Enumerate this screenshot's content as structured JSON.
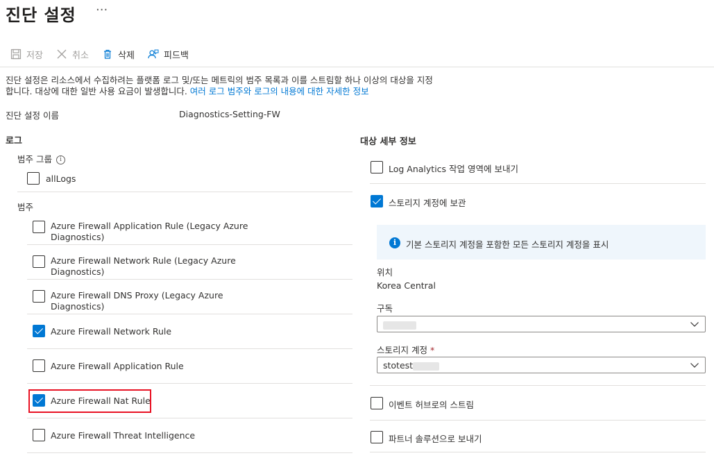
{
  "header": {
    "title": "진단 설정",
    "more": "···"
  },
  "toolbar": {
    "save_label": "저장",
    "cancel_label": "취소",
    "delete_label": "삭제",
    "feedback_label": "피드백"
  },
  "description": {
    "text_line1": "진단 설정은 리소스에서 수집하려는 플랫폼 로그 및/또는 메트릭의 범주 목록과 이를 스트림할 하나 이상의 대상을 지정",
    "text_line2": "합니다. 대상에 대한 일반 사용 요금이 발생합니다.",
    "link": "여러 로그 범주와 로그의 내용에 대한 자세한 정보"
  },
  "setting_name": {
    "label": "진단 설정 이름",
    "value": "Diagnostics-Setting-FW"
  },
  "logs": {
    "heading": "로그",
    "category_group_label": "범주 그룹",
    "category_group_info_icon": "info-icon",
    "alllogs": {
      "label": "allLogs",
      "checked": false
    },
    "categories_label": "범주",
    "categories": [
      {
        "label": "Azure Firewall Application Rule (Legacy Azure Diagnostics)",
        "checked": false
      },
      {
        "label": "Azure Firewall Network Rule (Legacy Azure Diagnostics)",
        "checked": false
      },
      {
        "label": "Azure Firewall DNS Proxy (Legacy Azure Diagnostics)",
        "checked": false
      },
      {
        "label": "Azure Firewall Network Rule",
        "checked": true
      },
      {
        "label": "Azure Firewall Application Rule",
        "checked": false
      },
      {
        "label": "Azure Firewall Nat Rule",
        "checked": true
      },
      {
        "label": "Azure Firewall Threat Intelligence",
        "checked": false
      }
    ]
  },
  "destination": {
    "heading": "대상 세부 정보",
    "log_analytics": {
      "label": "Log Analytics 작업 영역에 보내기",
      "checked": false
    },
    "storage": {
      "label": "스토리지 계정에 보관",
      "checked": true
    },
    "info_text": "기본 스토리지 계정을 포함한 모든 스토리지 계정을 표시",
    "location_label": "위치",
    "location_value": "Korea Central",
    "subscription_label": "구독",
    "subscription_value": "",
    "storage_account_label": "스토리지 계정",
    "required_mark": "*",
    "storage_account_value": "stotest",
    "event_hub": {
      "label": "이벤트 허브로의 스트림",
      "checked": false
    },
    "partner": {
      "label": "파트너 솔루션으로 보내기",
      "checked": false
    }
  },
  "colors": {
    "accent": "#0078d4",
    "highlight": "#e81123",
    "info_bg": "#eff6fc"
  }
}
